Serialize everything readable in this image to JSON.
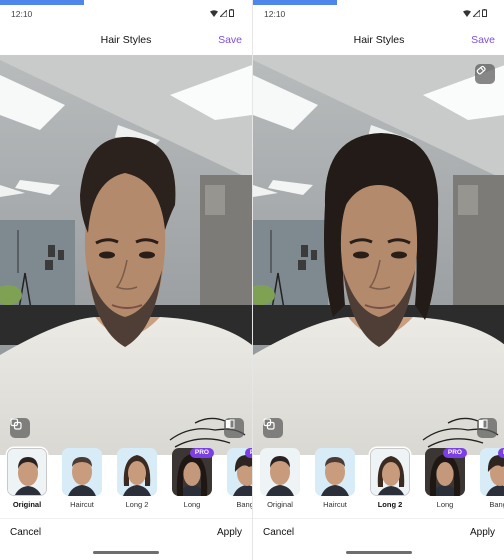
{
  "screens": [
    {
      "id": "left",
      "status": {
        "time": "12:10",
        "icons": [
          "wifi-icon",
          "signal-icon",
          "battery-icon"
        ]
      },
      "header": {
        "title": "Hair Styles",
        "save_label": "Save"
      },
      "tools": {
        "compare_icon": "layers-icon",
        "split_icon": "split-view-icon"
      },
      "styles": [
        {
          "label": "Original",
          "pro": false,
          "selected": true
        },
        {
          "label": "Haircut",
          "pro": false,
          "selected": false
        },
        {
          "label": "Long 2",
          "pro": false,
          "selected": false
        },
        {
          "label": "Long",
          "pro": true,
          "selected": false
        },
        {
          "label": "Bangs",
          "pro": true,
          "selected": false
        }
      ],
      "footer": {
        "cancel_label": "Cancel",
        "apply_label": "Apply"
      }
    },
    {
      "id": "right",
      "status": {
        "time": "12:10",
        "icons": [
          "wifi-icon",
          "signal-icon",
          "battery-icon"
        ]
      },
      "header": {
        "title": "Hair Styles",
        "save_label": "Save"
      },
      "tools": {
        "eraser_icon": "eraser-icon",
        "compare_icon": "layers-icon",
        "split_icon": "split-view-icon"
      },
      "styles": [
        {
          "label": "Original",
          "pro": false,
          "selected": false
        },
        {
          "label": "Haircut",
          "pro": false,
          "selected": false
        },
        {
          "label": "Long 2",
          "pro": false,
          "selected": true
        },
        {
          "label": "Long",
          "pro": true,
          "selected": false
        },
        {
          "label": "Bangs",
          "pro": true,
          "selected": false
        }
      ],
      "footer": {
        "cancel_label": "Cancel",
        "apply_label": "Apply"
      }
    }
  ],
  "pro_badge_label": "PRO",
  "colors": {
    "accent": "#7b4fe0",
    "pro_badge": "#7b3fe4",
    "top_accent": "#4f86ec"
  }
}
